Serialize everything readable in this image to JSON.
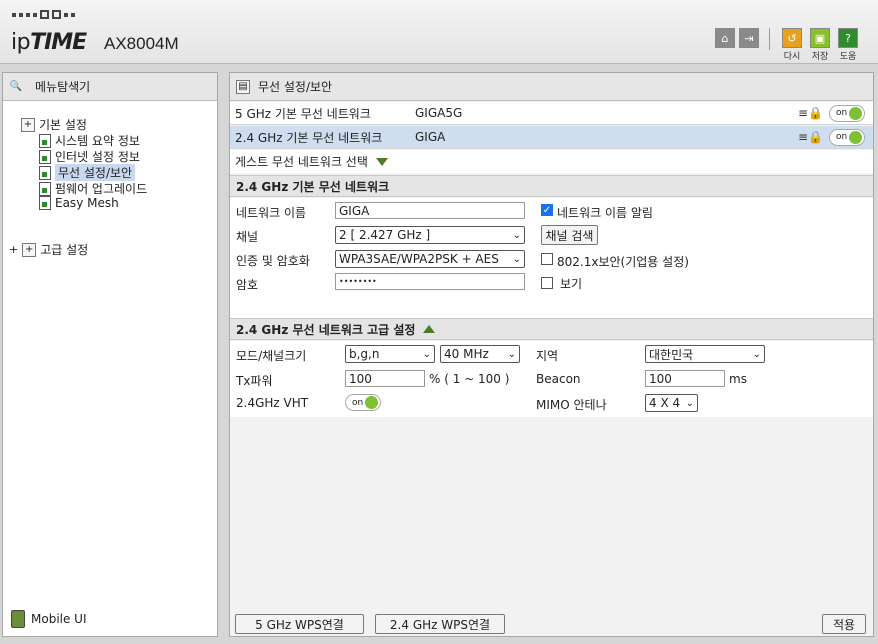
{
  "header": {
    "brand_prefix": "ip",
    "brand_bold": "TIME",
    "model": "AX8004M",
    "icons": [
      {
        "name": "home-icon"
      },
      {
        "name": "logout-icon"
      }
    ],
    "actions": [
      {
        "name": "restart",
        "caption": "다시"
      },
      {
        "name": "save",
        "caption": "저장"
      },
      {
        "name": "help",
        "caption": "도움"
      }
    ]
  },
  "sidebar": {
    "title": "메뉴탐색기",
    "basic": "기본 설정",
    "items": [
      {
        "label": "시스템 요약 정보"
      },
      {
        "label": "인터넷 설정 정보"
      },
      {
        "label": "무선 설정/보안"
      },
      {
        "label": "펌웨어 업그레이드"
      },
      {
        "label": "Easy Mesh"
      }
    ],
    "advanced": "고급 설정",
    "mobile": "Mobile UI"
  },
  "main": {
    "title": "무선 설정/보안",
    "networks": [
      {
        "label": "5 GHz 기본 무선 네트워크",
        "ssid": "GIGA5G",
        "toggle": "on"
      },
      {
        "label": "2.4 GHz 기본 무선 네트워크",
        "ssid": "GIGA",
        "toggle": "on"
      }
    ],
    "guest_select": "게스트 무선 네트워크 선택",
    "basic_section": {
      "title": "2.4 GHz 기본 무선 네트워크",
      "network_name_label": "네트워크 이름",
      "network_name_value": "GIGA",
      "broadcast_label": "네트워크 이름 알림",
      "channel_label": "채널",
      "channel_value": "2 [ 2.427 GHz ]",
      "channel_scan": "채널 검색",
      "auth_label": "인증 및 암호화",
      "auth_value": "WPA3SAE/WPA2PSK + AES",
      "enterprise_label": "802.1x보안(기업용 설정)",
      "password_label": "암호",
      "password_value": "••••••••",
      "show_label": "보기"
    },
    "advanced_section": {
      "title": "2.4 GHz 무선 네트워크 고급 설정",
      "mode_label": "모드/채널크기",
      "mode_value": "b,g,n",
      "width_value": "40 MHz",
      "region_label": "지역",
      "region_value": "대한민국",
      "tx_label": "Tx파워",
      "tx_value": "100",
      "tx_range": "% ( 1 ~ 100 )",
      "beacon_label": "Beacon",
      "beacon_value": "100",
      "beacon_unit": "ms",
      "vht_label": "2.4GHz VHT",
      "vht_toggle": "on",
      "mimo_label": "MIMO 안테나",
      "mimo_value": "4 X 4"
    },
    "buttons": {
      "wps5": "5 GHz WPS연결",
      "wps24": "2.4 GHz WPS연결",
      "apply": "적용"
    }
  }
}
